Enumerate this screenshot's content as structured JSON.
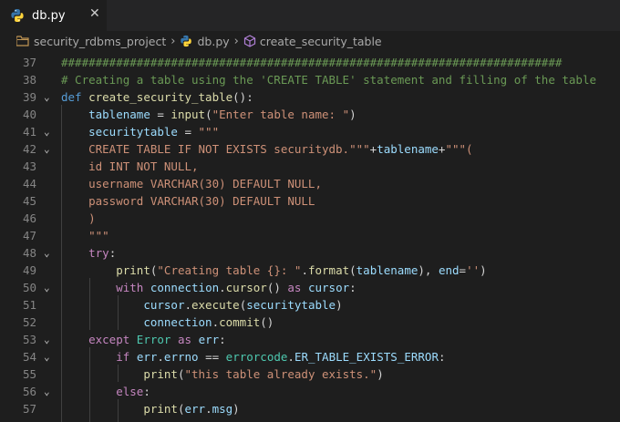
{
  "tab": {
    "filename": "db.py",
    "close_symbol": "✕"
  },
  "breadcrumb": {
    "project": "security_rdbms_project",
    "file": "db.py",
    "symbol": "create_security_table"
  },
  "colors": {
    "editor_bg": "#1e1e1e",
    "tab_bar_bg": "#252526",
    "line_number": "#858585"
  },
  "lines": [
    {
      "num": "37",
      "fold": false,
      "tokens": [
        {
          "t": "#########################################################################",
          "c": "cmt"
        }
      ]
    },
    {
      "num": "38",
      "fold": false,
      "tokens": [
        {
          "t": "# Creating a table using the 'CREATE TABLE' statement and filling of the table",
          "c": "cmt"
        }
      ]
    },
    {
      "num": "39",
      "fold": true,
      "tokens": [
        {
          "t": "def ",
          "c": "kw"
        },
        {
          "t": "create_security_table",
          "c": "fn"
        },
        {
          "t": "():",
          "c": "op"
        }
      ]
    },
    {
      "num": "40",
      "fold": false,
      "tokens": [
        {
          "t": "    ",
          "c": "op"
        },
        {
          "t": "tablename",
          "c": "var"
        },
        {
          "t": " = ",
          "c": "op"
        },
        {
          "t": "input",
          "c": "fn"
        },
        {
          "t": "(",
          "c": "op"
        },
        {
          "t": "\"Enter table name: \"",
          "c": "str"
        },
        {
          "t": ")",
          "c": "op"
        }
      ]
    },
    {
      "num": "41",
      "fold": true,
      "tokens": [
        {
          "t": "    ",
          "c": "op"
        },
        {
          "t": "securitytable",
          "c": "var"
        },
        {
          "t": " = ",
          "c": "op"
        },
        {
          "t": "\"\"\"",
          "c": "str"
        }
      ]
    },
    {
      "num": "42",
      "fold": true,
      "tokens": [
        {
          "t": "    CREATE TABLE IF NOT EXISTS securitydb.\"\"\"",
          "c": "str"
        },
        {
          "t": "+",
          "c": "op"
        },
        {
          "t": "tablename",
          "c": "var"
        },
        {
          "t": "+",
          "c": "op"
        },
        {
          "t": "\"\"\"(",
          "c": "str"
        }
      ]
    },
    {
      "num": "43",
      "fold": false,
      "tokens": [
        {
          "t": "    id INT NOT NULL,",
          "c": "str"
        }
      ]
    },
    {
      "num": "44",
      "fold": false,
      "tokens": [
        {
          "t": "    username VARCHAR(30) DEFAULT NULL,",
          "c": "str"
        }
      ]
    },
    {
      "num": "45",
      "fold": false,
      "tokens": [
        {
          "t": "    password VARCHAR(30) DEFAULT NULL",
          "c": "str"
        }
      ]
    },
    {
      "num": "46",
      "fold": false,
      "tokens": [
        {
          "t": "    )",
          "c": "str"
        }
      ]
    },
    {
      "num": "47",
      "fold": false,
      "tokens": [
        {
          "t": "    \"\"\"",
          "c": "str"
        }
      ]
    },
    {
      "num": "48",
      "fold": true,
      "tokens": [
        {
          "t": "    ",
          "c": "op"
        },
        {
          "t": "try",
          "c": "ctl"
        },
        {
          "t": ":",
          "c": "op"
        }
      ]
    },
    {
      "num": "49",
      "fold": false,
      "tokens": [
        {
          "t": "        ",
          "c": "op"
        },
        {
          "t": "print",
          "c": "fn"
        },
        {
          "t": "(",
          "c": "op"
        },
        {
          "t": "\"Creating table {}: \"",
          "c": "str"
        },
        {
          "t": ".",
          "c": "op"
        },
        {
          "t": "format",
          "c": "fn"
        },
        {
          "t": "(",
          "c": "op"
        },
        {
          "t": "tablename",
          "c": "var"
        },
        {
          "t": "), ",
          "c": "op"
        },
        {
          "t": "end",
          "c": "var"
        },
        {
          "t": "=",
          "c": "op"
        },
        {
          "t": "''",
          "c": "str"
        },
        {
          "t": ")",
          "c": "op"
        }
      ]
    },
    {
      "num": "50",
      "fold": true,
      "tokens": [
        {
          "t": "        ",
          "c": "op"
        },
        {
          "t": "with",
          "c": "ctl"
        },
        {
          "t": " ",
          "c": "op"
        },
        {
          "t": "connection",
          "c": "var"
        },
        {
          "t": ".",
          "c": "op"
        },
        {
          "t": "cursor",
          "c": "fn"
        },
        {
          "t": "() ",
          "c": "op"
        },
        {
          "t": "as",
          "c": "ctl"
        },
        {
          "t": " ",
          "c": "op"
        },
        {
          "t": "cursor",
          "c": "var"
        },
        {
          "t": ":",
          "c": "op"
        }
      ]
    },
    {
      "num": "51",
      "fold": false,
      "tokens": [
        {
          "t": "            ",
          "c": "op"
        },
        {
          "t": "cursor",
          "c": "var"
        },
        {
          "t": ".",
          "c": "op"
        },
        {
          "t": "execute",
          "c": "fn"
        },
        {
          "t": "(",
          "c": "op"
        },
        {
          "t": "securitytable",
          "c": "var"
        },
        {
          "t": ")",
          "c": "op"
        }
      ]
    },
    {
      "num": "52",
      "fold": false,
      "tokens": [
        {
          "t": "            ",
          "c": "op"
        },
        {
          "t": "connection",
          "c": "var"
        },
        {
          "t": ".",
          "c": "op"
        },
        {
          "t": "commit",
          "c": "fn"
        },
        {
          "t": "()",
          "c": "op"
        }
      ]
    },
    {
      "num": "53",
      "fold": true,
      "tokens": [
        {
          "t": "    ",
          "c": "op"
        },
        {
          "t": "except",
          "c": "ctl"
        },
        {
          "t": " ",
          "c": "op"
        },
        {
          "t": "Error",
          "c": "cls"
        },
        {
          "t": " ",
          "c": "op"
        },
        {
          "t": "as",
          "c": "ctl"
        },
        {
          "t": " ",
          "c": "op"
        },
        {
          "t": "err",
          "c": "var"
        },
        {
          "t": ":",
          "c": "op"
        }
      ]
    },
    {
      "num": "54",
      "fold": true,
      "tokens": [
        {
          "t": "        ",
          "c": "op"
        },
        {
          "t": "if",
          "c": "ctl"
        },
        {
          "t": " ",
          "c": "op"
        },
        {
          "t": "err",
          "c": "var"
        },
        {
          "t": ".",
          "c": "op"
        },
        {
          "t": "errno",
          "c": "var"
        },
        {
          "t": " == ",
          "c": "op"
        },
        {
          "t": "errorcode",
          "c": "cls"
        },
        {
          "t": ".",
          "c": "op"
        },
        {
          "t": "ER_TABLE_EXISTS_ERROR",
          "c": "var"
        },
        {
          "t": ":",
          "c": "op"
        }
      ]
    },
    {
      "num": "55",
      "fold": false,
      "tokens": [
        {
          "t": "            ",
          "c": "op"
        },
        {
          "t": "print",
          "c": "fn"
        },
        {
          "t": "(",
          "c": "op"
        },
        {
          "t": "\"this table already exists.\"",
          "c": "str"
        },
        {
          "t": ")",
          "c": "op"
        }
      ]
    },
    {
      "num": "56",
      "fold": true,
      "tokens": [
        {
          "t": "        ",
          "c": "op"
        },
        {
          "t": "else",
          "c": "ctl"
        },
        {
          "t": ":",
          "c": "op"
        }
      ]
    },
    {
      "num": "57",
      "fold": false,
      "tokens": [
        {
          "t": "            ",
          "c": "op"
        },
        {
          "t": "print",
          "c": "fn"
        },
        {
          "t": "(",
          "c": "op"
        },
        {
          "t": "err",
          "c": "var"
        },
        {
          "t": ".",
          "c": "op"
        },
        {
          "t": "msg",
          "c": "var"
        },
        {
          "t": ")",
          "c": "op"
        }
      ]
    }
  ]
}
